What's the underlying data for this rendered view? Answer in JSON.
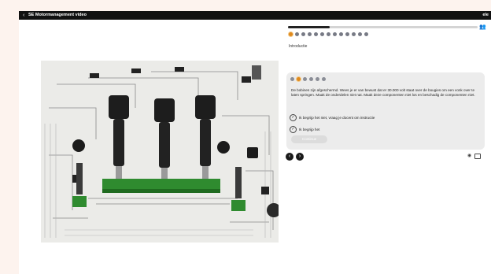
{
  "window": {
    "title": "SE Motormanagement video",
    "right_label": "ele"
  },
  "progress": {
    "fraction": 0.22
  },
  "steps": {
    "count": 13,
    "active_index": 0
  },
  "section": {
    "label": "Introductie"
  },
  "card": {
    "substeps": {
      "count": 6,
      "active_index": 1
    },
    "message": "De bobines zijn afgeschermd. Wees je er van bewust dat er 30.000 volt staat over de bougies om een vonk over te laten springen. Maak de onderdelen niet nat. Maak deze componenten niet los en beschadig de componenten niet.",
    "option1": "Ik begrijp het niet, vraag je docent om instructie",
    "option2": "Ik begrijp het",
    "continue_label": "Continue"
  },
  "icons": {
    "back": "chevron-left-icon",
    "people": "people-icon",
    "prev": "arrow-left-icon",
    "next": "arrow-right-icon",
    "eye": "eye-icon",
    "fullscreen": "window-icon"
  },
  "colors": {
    "accent": "#e08a1e",
    "topbar": "#111111",
    "card": "#ececec"
  }
}
